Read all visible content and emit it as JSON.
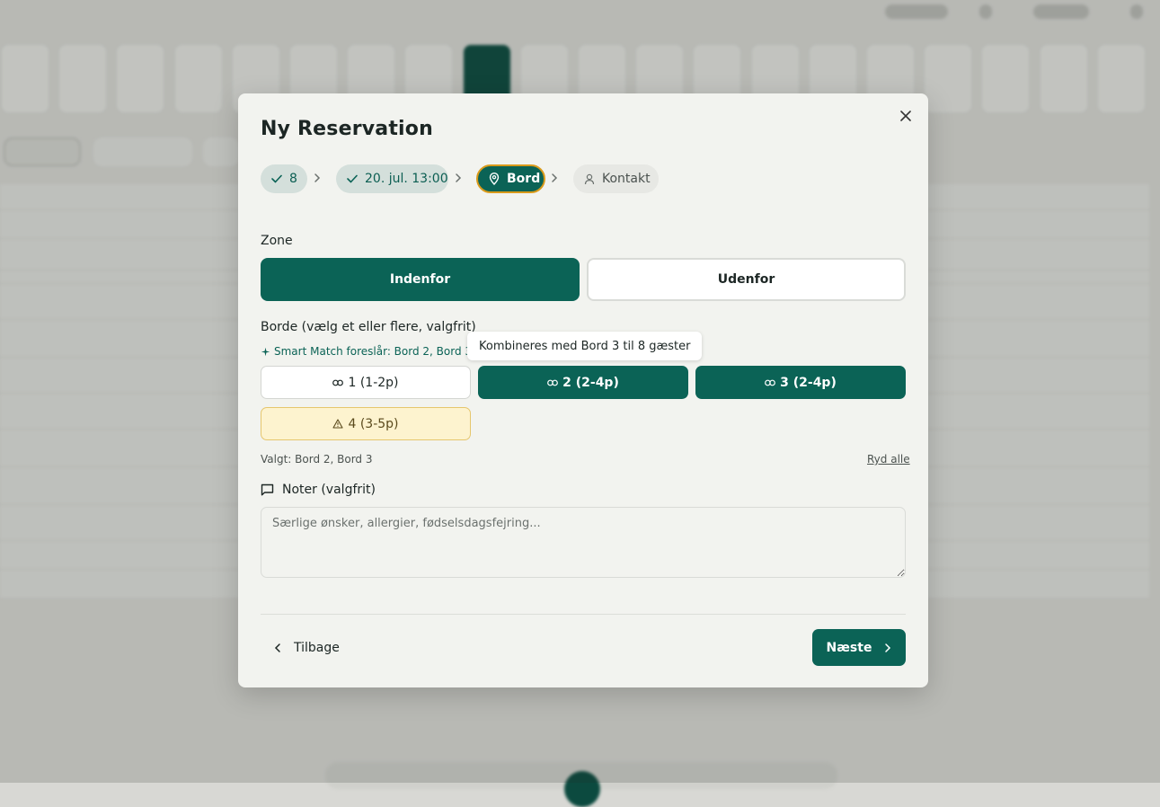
{
  "modal": {
    "title": "Ny Reservation",
    "close_icon": "close-icon"
  },
  "steps": [
    {
      "label": "8",
      "state": "done",
      "icon": "check-icon"
    },
    {
      "label": "20. jul. 13:00",
      "state": "done",
      "icon": "check-icon"
    },
    {
      "label": "Bord",
      "state": "active",
      "icon": "map-pin-icon"
    },
    {
      "label": "Kontakt",
      "state": "todo",
      "icon": "user-icon"
    }
  ],
  "zone": {
    "label": "Zone",
    "options": [
      "Indenfor",
      "Udenfor"
    ],
    "selected": "Indenfor"
  },
  "tables": {
    "label": "Borde (vælg et eller flere, valgfrit)",
    "smart_match": "Smart Match foreslår: Bord 2, Bord 3",
    "tooltip": "Kombineres med Bord 3 til 8 gæster",
    "items": [
      {
        "label": "1 (1-2p)",
        "state": "free",
        "icon": "link-icon"
      },
      {
        "label": "2 (2-4p)",
        "state": "selected",
        "icon": "link-icon"
      },
      {
        "label": "3 (2-4p)",
        "state": "selected",
        "icon": "link-icon"
      },
      {
        "label": "4 (3-5p)",
        "state": "warning",
        "icon": "warning-icon"
      }
    ],
    "selected_text": "Valgt: Bord 2, Bord 3",
    "clear_label": "Ryd alle"
  },
  "notes": {
    "label": "Noter (valgfrit)",
    "placeholder": "Særlige ønsker, allergier, fødselsdagsfejring..."
  },
  "footer": {
    "back_label": "Tilbage",
    "next_label": "Næste"
  },
  "colors": {
    "primary": "#0b6356",
    "active_ring": "#d99a1a",
    "warning_bg": "#fdf3cf",
    "modal_bg": "#f2f3ef"
  }
}
